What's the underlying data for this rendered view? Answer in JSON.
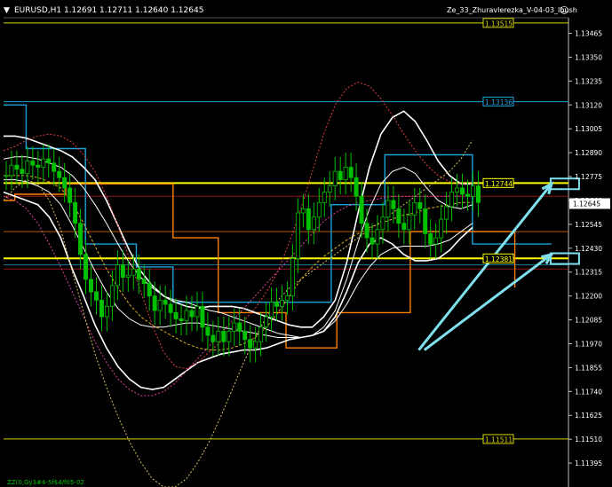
{
  "header": {
    "symbol_info": "EURUSD,H1  1.12691 1.12711 1.12640 1.12645",
    "indicator_name": "Ze_33_Zhuravlerezka_V-04-03_Ibush",
    "smiley": "☺"
  },
  "footer": {
    "label": "ZZ(0,Gy3#4-5f$4/f05-02"
  },
  "colors": {
    "background": "#000000",
    "axis": "#c0c0c0",
    "bull_candle": "#00c000",
    "bear_candle": "#00c000",
    "yellow": "#ffff00",
    "cyan": "#1aa3d9",
    "white": "#ffffff",
    "orange": "#ff8000",
    "light_cyan": "#7fe0ee"
  },
  "chart_data": {
    "type": "candlestick",
    "ylim": [
      1.1128,
      1.1354
    ],
    "y_ticks": [
      "1.13465",
      "1.13350",
      "1.13235",
      "1.13120",
      "1.13005",
      "1.12890",
      "1.12775",
      "1.12660",
      "1.12545",
      "1.12430",
      "1.12315",
      "1.12200",
      "1.12085",
      "1.11970",
      "1.11855",
      "1.11740",
      "1.11625",
      "1.11510",
      "1.11395"
    ],
    "price_marker": "1.12645",
    "levels": [
      {
        "label": "1.13515",
        "value": 1.13515,
        "color": "#d4d400",
        "style": "thin"
      },
      {
        "label": "1.13136",
        "value": 1.13136,
        "color": "#1aa3d9",
        "style": "thin"
      },
      {
        "label": "1.12744",
        "value": 1.12744,
        "color": "#ffff00",
        "style": "thick"
      },
      {
        "label": "1.12381",
        "value": 1.12381,
        "color": "#ffff00",
        "style": "thick"
      },
      {
        "label": "1.11511",
        "value": 1.11511,
        "color": "#d4d400",
        "style": "thin"
      }
    ],
    "hidden_levels": [
      {
        "value": 1.1268,
        "color": "#cc2222"
      },
      {
        "value": 1.1251,
        "color": "#ff8000"
      },
      {
        "value": 1.1233,
        "color": "#cc2222"
      },
      {
        "value": 1.1235,
        "color": "#1aa3d9"
      }
    ],
    "closes": [
      1.1278,
      1.1283,
      1.1281,
      1.1279,
      1.1285,
      1.1283,
      1.1282,
      1.1286,
      1.1284,
      1.128,
      1.1277,
      1.1272,
      1.1265,
      1.1255,
      1.124,
      1.1228,
      1.1222,
      1.1218,
      1.121,
      1.1215,
      1.1225,
      1.1235,
      1.1229,
      1.123,
      1.1233,
      1.1228,
      1.1226,
      1.122,
      1.1213,
      1.1218,
      1.1216,
      1.1212,
      1.1209,
      1.1208,
      1.1213,
      1.121,
      1.1215,
      1.1205,
      1.1201,
      1.1198,
      1.1203,
      1.1198,
      1.1203,
      1.1207,
      1.1203,
      1.1199,
      1.1195,
      1.1198,
      1.1205,
      1.121,
      1.1217,
      1.1215,
      1.1218,
      1.122,
      1.1238,
      1.126,
      1.1262,
      1.1252,
      1.1258,
      1.1265,
      1.127,
      1.1273,
      1.128,
      1.1276,
      1.1282,
      1.1277,
      1.1268,
      1.1255,
      1.1248,
      1.1245,
      1.1252,
      1.1258,
      1.1266,
      1.1262,
      1.1255,
      1.1252,
      1.1259,
      1.1265,
      1.1262,
      1.125,
      1.1245,
      1.1248,
      1.1257,
      1.1263,
      1.127,
      1.1272,
      1.1269,
      1.1268,
      1.1273,
      1.1265
    ],
    "overlays": [
      {
        "name": "",
        "color": "#ffffff",
        "width": 1.6,
        "dash": "",
        "values": [
          1.1297,
          1.1297,
          1.1296,
          1.1294,
          1.1292,
          1.129,
          1.1287,
          1.1282,
          1.1276,
          1.1266,
          1.1254,
          1.1242,
          1.1232,
          1.1225,
          1.122,
          1.1217,
          1.1215,
          1.1214,
          1.1215,
          1.1215,
          1.1215,
          1.1214,
          1.1212,
          1.121,
          1.1208,
          1.1206,
          1.1205,
          1.1205,
          1.121,
          1.1218,
          1.1236,
          1.126,
          1.1282,
          1.1298,
          1.1306,
          1.1309,
          1.1304,
          1.1295,
          1.1285,
          1.1278,
          1.1274,
          1.1274
        ]
      },
      {
        "name": "",
        "color": "#ffffff",
        "width": 1.6,
        "dash": "",
        "values": [
          1.127,
          1.1268,
          1.1266,
          1.1264,
          1.1258,
          1.1248,
          1.1233,
          1.122,
          1.1206,
          1.1195,
          1.1186,
          1.118,
          1.1176,
          1.1175,
          1.1176,
          1.118,
          1.1184,
          1.1188,
          1.119,
          1.1192,
          1.1193,
          1.1194,
          1.1194,
          1.1195,
          1.1197,
          1.1199,
          1.12,
          1.1201,
          1.1203,
          1.121,
          1.1222,
          1.1236,
          1.1245,
          1.1248,
          1.1245,
          1.124,
          1.1237,
          1.1237,
          1.1238,
          1.1242,
          1.1248,
          1.1253
        ]
      },
      {
        "name": "",
        "color": "#ffffff",
        "width": 1,
        "dash": "",
        "values": [
          1.1286,
          1.1287,
          1.1287,
          1.1286,
          1.1284,
          1.1282,
          1.1278,
          1.1272,
          1.1264,
          1.1255,
          1.1245,
          1.1236,
          1.1229,
          1.1224,
          1.122,
          1.1218,
          1.1217,
          1.1215,
          1.1213,
          1.1212,
          1.121,
          1.1208,
          1.1206,
          1.1204,
          1.1202,
          1.1201,
          1.12,
          1.1201,
          1.1205,
          1.1213,
          1.1228,
          1.1246,
          1.1262,
          1.1274,
          1.128,
          1.1282,
          1.1279,
          1.1272,
          1.1266,
          1.1263,
          1.1262,
          1.1264
        ]
      },
      {
        "name": "",
        "color": "#ffffff",
        "width": 1,
        "dash": "",
        "values": [
          1.1276,
          1.1276,
          1.1275,
          1.1273,
          1.127,
          1.1264,
          1.1254,
          1.1243,
          1.1232,
          1.1222,
          1.1214,
          1.1209,
          1.1206,
          1.1205,
          1.1205,
          1.1206,
          1.1207,
          1.1207,
          1.1206,
          1.1205,
          1.1204,
          1.1203,
          1.1202,
          1.1201,
          1.12,
          1.12,
          1.12,
          1.1201,
          1.1203,
          1.1208,
          1.1216,
          1.1226,
          1.1234,
          1.124,
          1.1243,
          1.1244,
          1.1244,
          1.1244,
          1.1245,
          1.1247,
          1.1251,
          1.1255
        ]
      },
      {
        "name": "",
        "color": "#e04040",
        "width": 1,
        "dash": "2,2",
        "values": [
          1.129,
          1.1292,
          1.1295,
          1.1297,
          1.1298,
          1.1297,
          1.1294,
          1.1288,
          1.128,
          1.1268,
          1.1254,
          1.1238,
          1.1222,
          1.1206,
          1.1193,
          1.1186,
          1.1185,
          1.1188,
          1.1193,
          1.1198,
          1.1203,
          1.1208,
          1.1214,
          1.1222,
          1.1232,
          1.1246,
          1.1262,
          1.128,
          1.1298,
          1.1312,
          1.132,
          1.1323,
          1.1321,
          1.1315,
          1.1307,
          1.1298,
          1.129,
          1.1283,
          1.1278,
          1.1275,
          1.1274,
          1.1274
        ]
      },
      {
        "name": "",
        "color": "#e040a0",
        "width": 1,
        "dash": "2,2",
        "values": [
          1.1268,
          1.1266,
          1.1262,
          1.1255,
          1.1245,
          1.1234,
          1.1222,
          1.121,
          1.1198,
          1.1188,
          1.118,
          1.1175,
          1.1172,
          1.1172,
          1.1174,
          1.1178,
          1.1184,
          1.119,
          1.1196,
          1.1202,
          1.1208,
          1.1214,
          1.122,
          1.1226,
          1.1232,
          1.1238,
          1.1244,
          1.125,
          1.1256,
          1.126,
          1.1263,
          1.1265,
          1.1266,
          1.1267,
          1.1268,
          1.1268,
          1.1268,
          1.1268,
          1.1268,
          1.1268,
          1.1268,
          1.1268
        ]
      },
      {
        "name": "",
        "color": "#d8c060",
        "width": 1,
        "dash": "2,2",
        "values": [
          1.1266,
          1.1272,
          1.1276,
          1.1274,
          1.1266,
          1.1252,
          1.1232,
          1.1212,
          1.1192,
          1.1176,
          1.1162,
          1.115,
          1.114,
          1.1132,
          1.1128,
          1.1128,
          1.1132,
          1.114,
          1.115,
          1.1162,
          1.1175,
          1.1188,
          1.12,
          1.121,
          1.1218,
          1.1224,
          1.1228,
          1.1232,
          1.1236,
          1.124,
          1.1244,
          1.1248,
          1.1252,
          1.1256,
          1.126,
          1.1264,
          1.1268,
          1.1272,
          1.1276,
          1.128,
          1.1286,
          1.1295
        ]
      },
      {
        "name": "",
        "color": "#e0b020",
        "width": 1,
        "dash": "3,2",
        "values": [
          1.1278,
          1.1278,
          1.1278,
          1.1277,
          1.1275,
          1.1272,
          1.1265,
          1.1255,
          1.1244,
          1.1233,
          1.1224,
          1.1216,
          1.121,
          1.1206,
          1.1203,
          1.12,
          1.1197,
          1.1195,
          1.1194,
          1.1194,
          1.1195,
          1.1197,
          1.12,
          1.1205,
          1.1212,
          1.122,
          1.1228,
          1.1234,
          1.1239,
          1.1243,
          1.1247,
          1.125,
          1.1253,
          1.1255,
          1.1257,
          1.1259,
          1.126,
          1.1262,
          1.1263,
          1.1264,
          1.1265,
          1.1265
        ]
      }
    ],
    "step_lines": [
      {
        "color": "#1aa3d9",
        "points": [
          [
            0,
            1.1312
          ],
          [
            0.04,
            1.1312
          ],
          [
            0.04,
            1.1291
          ],
          [
            0.145,
            1.1291
          ],
          [
            0.145,
            1.1245
          ],
          [
            0.235,
            1.1245
          ],
          [
            0.235,
            1.1234
          ],
          [
            0.3,
            1.1234
          ],
          [
            0.3,
            1.1217
          ],
          [
            0.44,
            1.1217
          ],
          [
            0.44,
            1.1217
          ],
          [
            0.58,
            1.1217
          ],
          [
            0.58,
            1.1264
          ],
          [
            0.675,
            1.1264
          ],
          [
            0.675,
            1.1288
          ],
          [
            0.76,
            1.1288
          ],
          [
            0.76,
            1.1288
          ],
          [
            0.83,
            1.1288
          ],
          [
            0.83,
            1.1245
          ],
          [
            0.97,
            1.1245
          ]
        ]
      },
      {
        "name": "",
        "color": "#ff8000",
        "points": [
          [
            0,
            1.1266
          ],
          [
            0.02,
            1.1266
          ],
          [
            0.02,
            1.1269
          ],
          [
            0.11,
            1.1269
          ],
          [
            0.11,
            1.1274
          ],
          [
            0.2,
            1.1274
          ],
          [
            0.2,
            1.1274
          ],
          [
            0.3,
            1.1274
          ],
          [
            0.3,
            1.1248
          ],
          [
            0.38,
            1.1248
          ],
          [
            0.38,
            1.1212
          ],
          [
            0.5,
            1.1212
          ],
          [
            0.5,
            1.1195
          ],
          [
            0.59,
            1.1195
          ],
          [
            0.59,
            1.1212
          ],
          [
            0.69,
            1.1212
          ],
          [
            0.69,
            1.1212
          ],
          [
            0.72,
            1.1212
          ],
          [
            0.72,
            1.1251
          ],
          [
            0.84,
            1.1251
          ],
          [
            0.84,
            1.1251
          ],
          [
            0.905,
            1.1251
          ],
          [
            0.905,
            1.1224
          ]
        ]
      }
    ],
    "cyan_arrows": [
      {
        "from": [
          0.735,
          1.1194
        ],
        "to": [
          0.97,
          1.1274
        ]
      },
      {
        "from": [
          0.745,
          1.1194
        ],
        "to": [
          0.97,
          1.124
        ]
      }
    ],
    "cyan_boxes": [
      1.1274,
      1.1238
    ]
  }
}
